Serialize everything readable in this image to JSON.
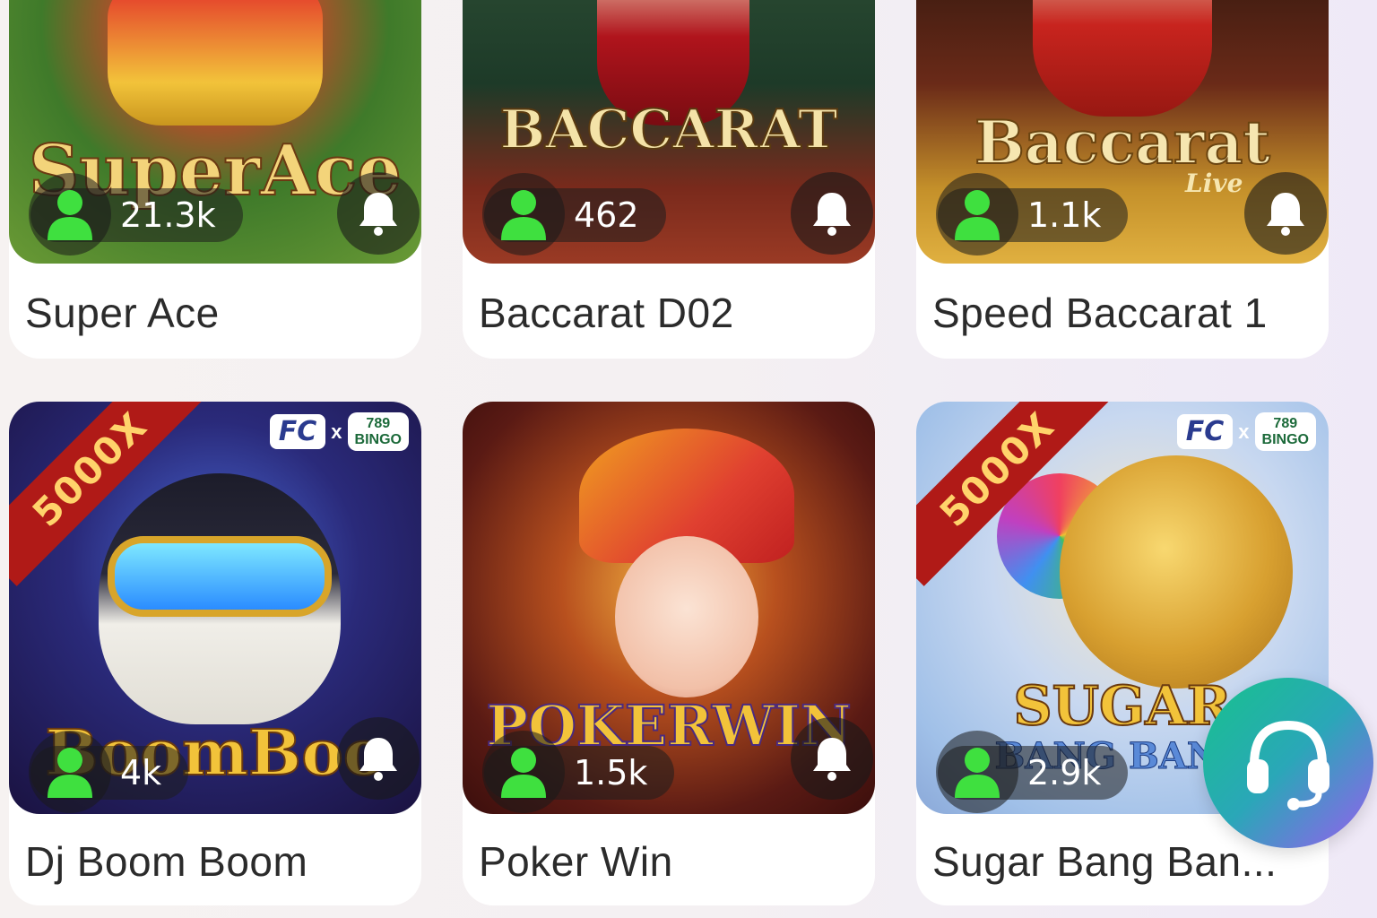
{
  "games": [
    {
      "title": "Super Ace",
      "players": "21.3k",
      "logo_text": "SuperAce"
    },
    {
      "title": "Baccarat D02",
      "players": "462",
      "logo_text": "BACCARAT"
    },
    {
      "title": "Speed Baccarat 1",
      "players": "1.1k",
      "logo_text": "Baccarat",
      "logo_sub": "Live"
    },
    {
      "title": "Dj Boom Boom",
      "players": "4k",
      "logo_text": "BoomBoo",
      "ribbon": "5000X",
      "brand_fc": "FC",
      "brand_x": "x",
      "brand_bingo_num": "789",
      "brand_bingo": "BINGO"
    },
    {
      "title": "Poker Win",
      "players": "1.5k",
      "logo_text": "POKERWIN"
    },
    {
      "title": "Sugar Bang Ban...",
      "players": "2.9k",
      "logo_text": "SUGAR",
      "logo_sub": "BANG BANG",
      "ribbon": "5000X",
      "brand_fc": "FC",
      "brand_x": "x",
      "brand_bingo_num": "789",
      "brand_bingo": "BINGO"
    }
  ],
  "icons": {
    "players": "user-icon",
    "notify": "bell-icon",
    "support": "headset-icon"
  },
  "colors": {
    "user_icon": "#3fe03f",
    "card_bg": "#ffffff",
    "ribbon": "#b01a17",
    "support_gradient_start": "#17c28c",
    "support_gradient_end": "#9a5cf0"
  }
}
